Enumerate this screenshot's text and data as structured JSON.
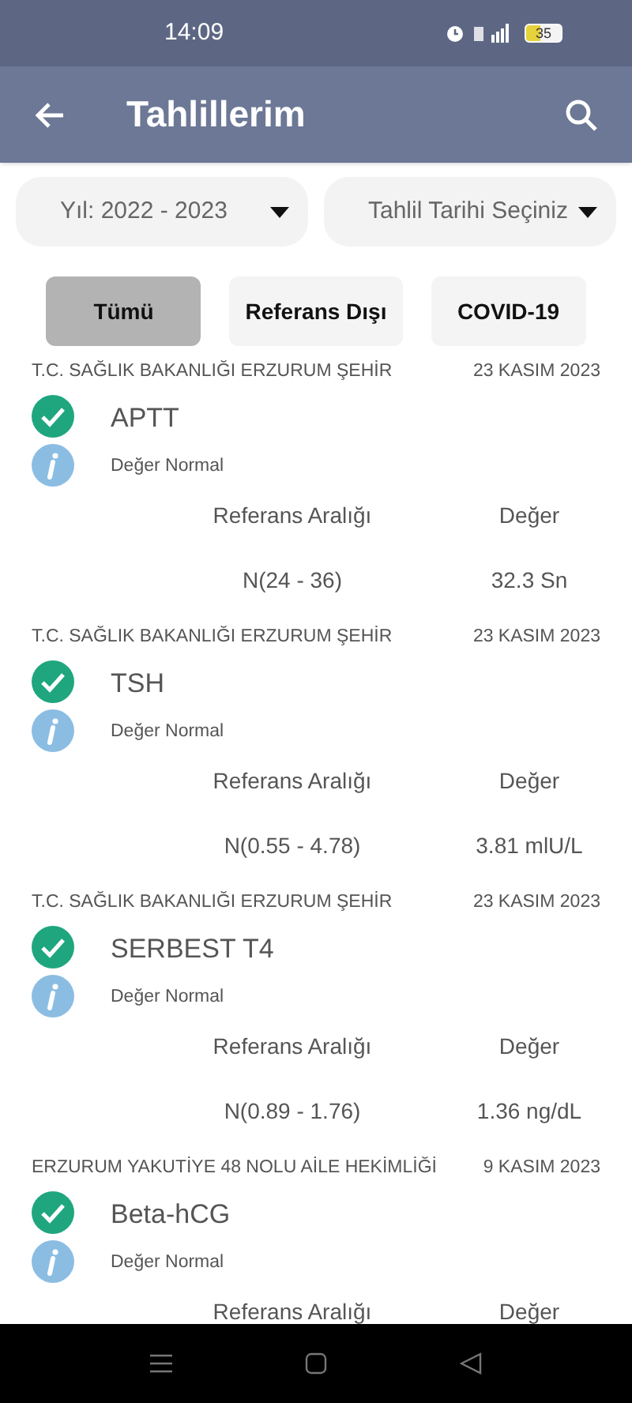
{
  "status_bar": {
    "time": "14:09",
    "battery": "35"
  },
  "app_bar": {
    "title": "Tahlillerim"
  },
  "filters": [
    {
      "label": "Yıl: 2022 - 2023"
    },
    {
      "label": "Tahlil Tarihi Seçiniz"
    }
  ],
  "tabs": [
    {
      "label": "Tümü",
      "selected": true
    },
    {
      "label": "Referans Dışı",
      "selected": false
    },
    {
      "label": "COVID-19",
      "selected": false
    }
  ],
  "results": [
    {
      "institution": "T.C. SAĞLIK BAKANLIĞI ERZURUM ŞEHİR",
      "date": "23 KASIM 2023",
      "test": "APTT",
      "status": "Değer Normal",
      "normal": true,
      "ref_label": "Referans Aralığı",
      "value_label": "Değer",
      "ref": "N(24 - 36)",
      "value": "32.3 Sn"
    },
    {
      "institution": "T.C. SAĞLIK BAKANLIĞI ERZURUM ŞEHİR",
      "date": "23 KASIM 2023",
      "test": "TSH",
      "status": "Değer Normal",
      "normal": true,
      "ref_label": "Referans Aralığı",
      "value_label": "Değer",
      "ref": "N(0.55 - 4.78)",
      "value": "3.81 mlU/L"
    },
    {
      "institution": "T.C. SAĞLIK BAKANLIĞI ERZURUM ŞEHİR",
      "date": "23 KASIM 2023",
      "test": "SERBEST T4",
      "status": "Değer Normal",
      "normal": true,
      "ref_label": "Referans Aralığı",
      "value_label": "Değer",
      "ref": "N(0.89 - 1.76)",
      "value": "1.36 ng/dL"
    },
    {
      "institution": "ERZURUM YAKUTİYE 48 NOLU AİLE HEKİMLİĞİ",
      "date": "9 KASIM 2023",
      "test": "Beta-hCG",
      "status": "Değer Normal",
      "normal": true,
      "ref_label": "Referans Aralığı",
      "value_label": "Değer"
    }
  ]
}
